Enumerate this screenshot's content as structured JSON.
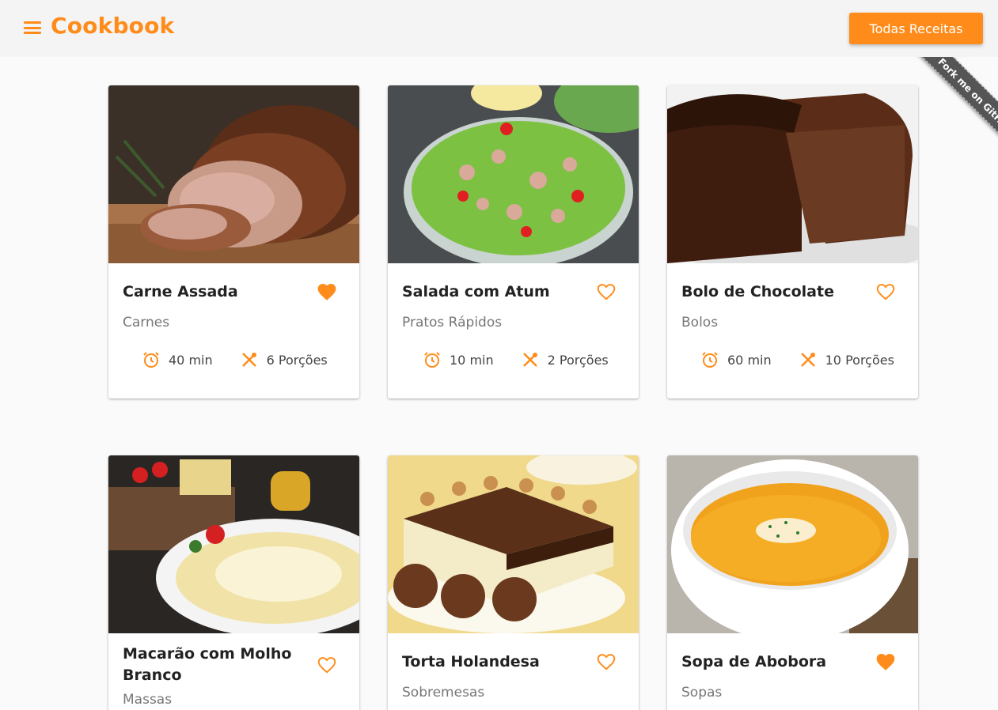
{
  "header": {
    "brand": "Cookbook",
    "all_recipes_button": "Todas Receitas",
    "ribbon": "Fork me on GitHub"
  },
  "colors": {
    "accent": "#ff8c1a",
    "header_bg": "#f4f4f4"
  },
  "recipes": [
    {
      "title": "Carne Assada",
      "category": "Carnes",
      "time": "40 min",
      "servings": "6 Porções",
      "favorite": true,
      "image": "roast-beef"
    },
    {
      "title": "Salada com Atum",
      "category": "Pratos Rápidos",
      "time": "10 min",
      "servings": "2 Porções",
      "favorite": false,
      "image": "tuna-salad"
    },
    {
      "title": "Bolo de Chocolate",
      "category": "Bolos",
      "time": "60 min",
      "servings": "10 Porções",
      "favorite": false,
      "image": "chocolate-cake"
    },
    {
      "title": "Macarão com Molho Branco",
      "category": "Massas",
      "favorite": false,
      "image": "pasta-white-sauce"
    },
    {
      "title": "Torta Holandesa",
      "category": "Sobremesas",
      "favorite": false,
      "image": "dutch-pie"
    },
    {
      "title": "Sopa de Abobora",
      "category": "Sopas",
      "favorite": true,
      "image": "pumpkin-soup"
    }
  ]
}
